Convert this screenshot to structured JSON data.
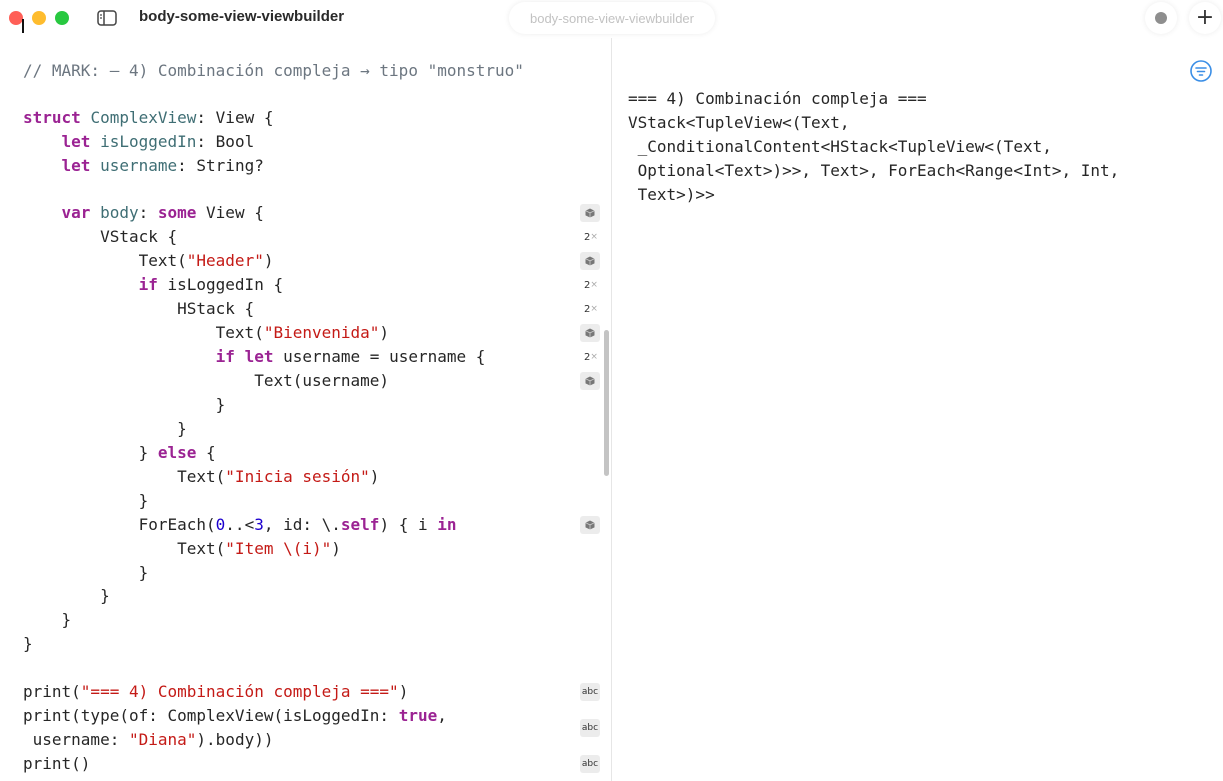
{
  "window": {
    "title": "body-some-view-viewbuilder",
    "tab_title": "body-some-view-viewbuilder"
  },
  "icons": {
    "sidebar_toggle": "sidebar-toggle-icon",
    "record": "record-icon",
    "add": "plus-icon",
    "filter": "filter-icon",
    "result_box": "box-icon"
  },
  "toolbar": {
    "add_label": "+"
  },
  "colors": {
    "keyword": "#9b2393",
    "type": "#3f6e74",
    "string": "#c41a16",
    "number": "#1c00cf",
    "comment": "#6c7680",
    "accent": "#3a8ee6"
  },
  "editor": {
    "lines": [
      "// MARK: – 4) Combinación compleja → tipo \"monstruo\"",
      "",
      "struct ComplexView: View {",
      "    let isLoggedIn: Bool",
      "    let username: String?",
      "",
      "    var body: some View {",
      "        VStack {",
      "            Text(\"Header\")",
      "            if isLoggedIn {",
      "                HStack {",
      "                    Text(\"Bienvenida\")",
      "                    if let username = username {",
      "                        Text(username)",
      "                    }",
      "                }",
      "            } else {",
      "                Text(\"Inicia sesión\")",
      "            }",
      "            ForEach(0..<3, id: \\.self) { i in",
      "                Text(\"Item \\(i)\")",
      "            }",
      "        }",
      "    }",
      "}",
      "",
      "print(\"=== 4) Combinación compleja ===\")",
      "print(type(of: ComplexView(isLoggedIn: true,",
      " username: \"Diana\").body))",
      "print()"
    ],
    "gutter_counts": [
      "2",
      "2",
      "2",
      "2"
    ],
    "gutter_x": "×",
    "gutter_abc": [
      "abc",
      "abc",
      "abc"
    ]
  },
  "console": {
    "lines": [
      "=== 4) Combinación compleja ===",
      "VStack<TupleView<(Text,",
      " _ConditionalContent<HStack<TupleView<(Text,",
      " Optional<Text>)>>, Text>, ForEach<Range<Int>, Int,",
      " Text>)>>"
    ]
  }
}
